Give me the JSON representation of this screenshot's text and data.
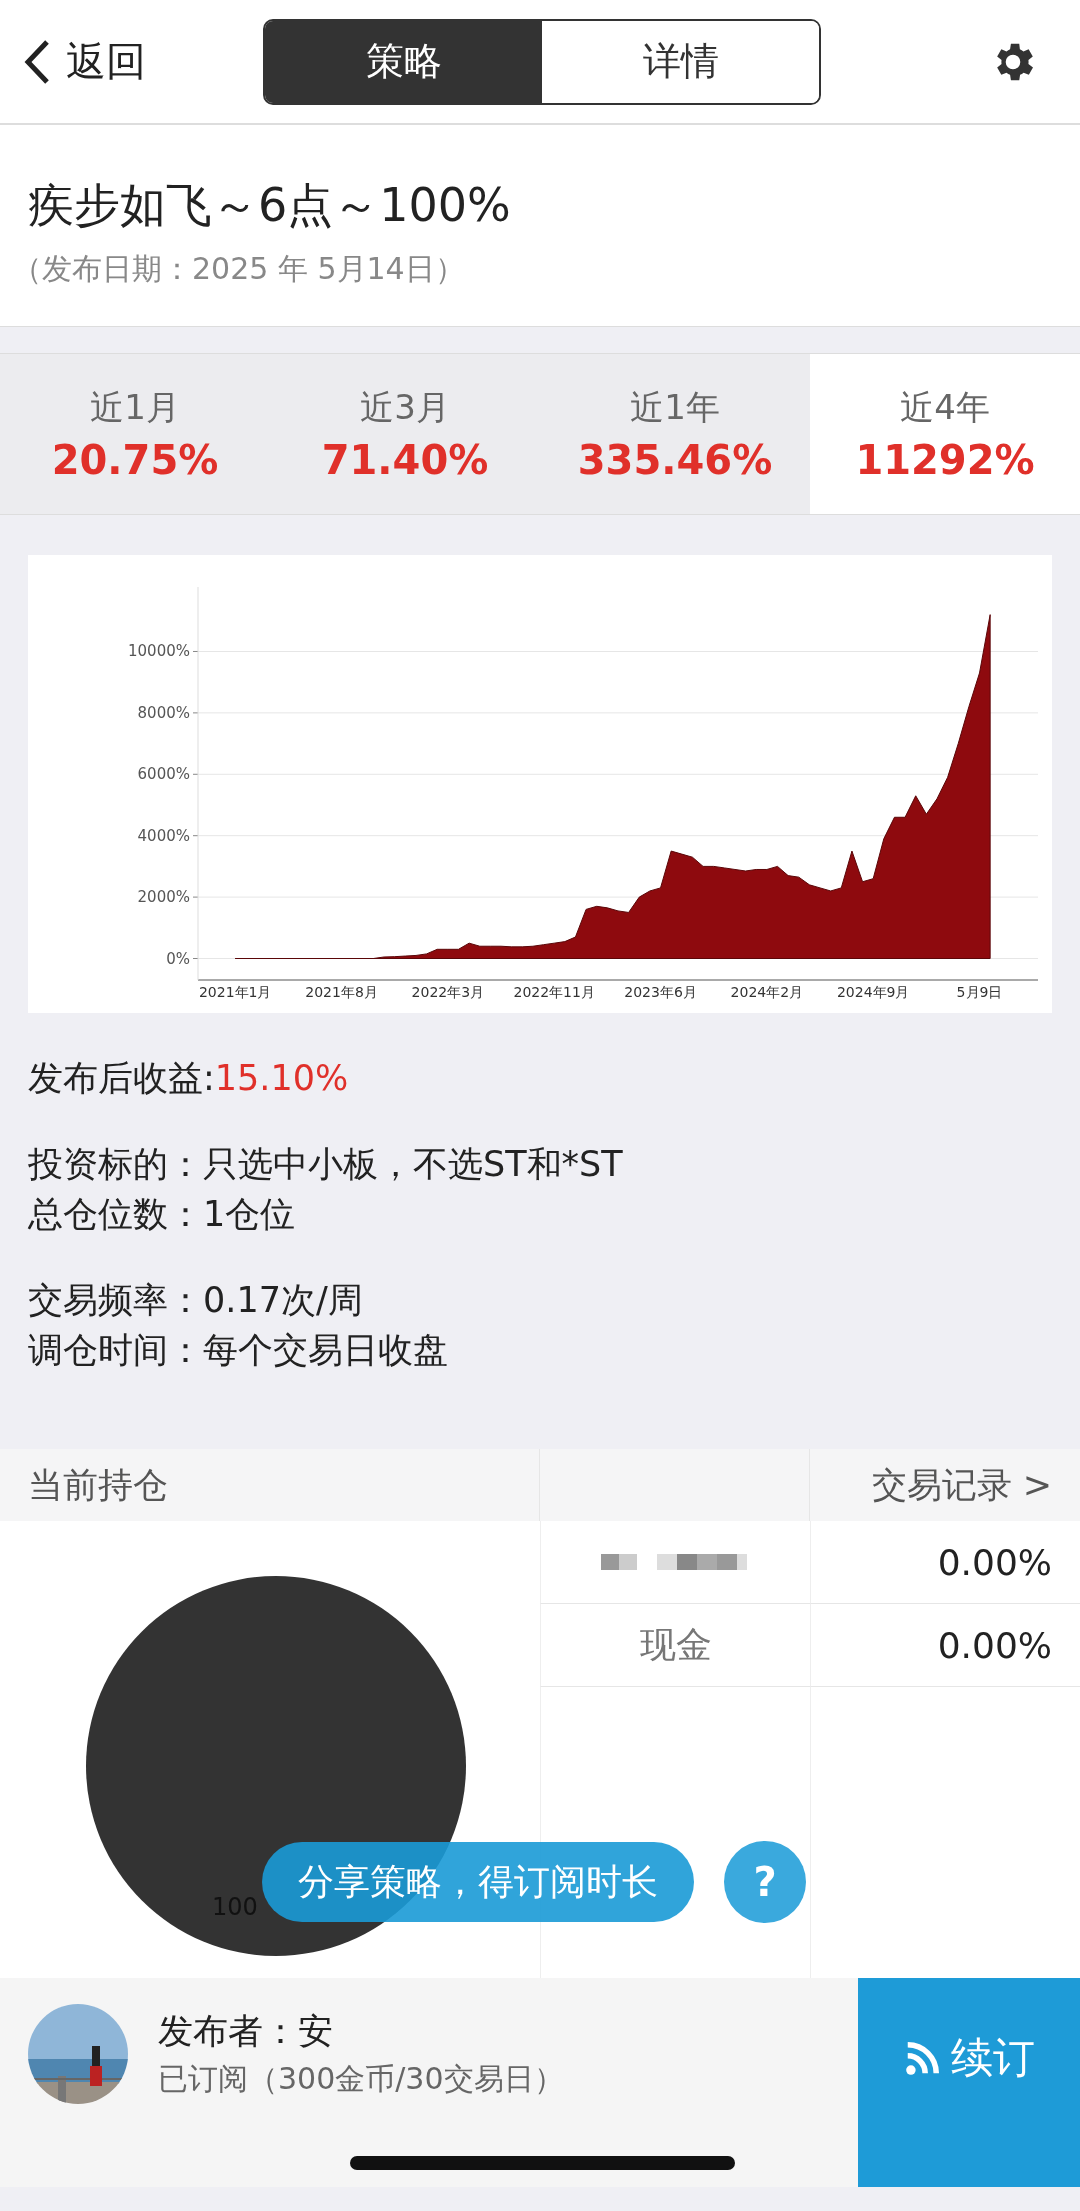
{
  "nav": {
    "back": "返回",
    "segments": [
      {
        "label": "策略",
        "selected": true
      },
      {
        "label": "详情",
        "selected": false
      }
    ]
  },
  "strategy": {
    "title": "疾步如飞～6点～100%",
    "date": "（发布日期：2025 年 5月14日）"
  },
  "periods": [
    {
      "label": "近1月",
      "value": "20.75%",
      "selected": false
    },
    {
      "label": "近3月",
      "value": "71.40%",
      "selected": false
    },
    {
      "label": "近1年",
      "value": "335.46%",
      "selected": false
    },
    {
      "label": "近4年",
      "value": "11292%",
      "selected": true
    }
  ],
  "chart_data": {
    "type": "area",
    "categories": [
      "2021年1月",
      null,
      null,
      null,
      null,
      null,
      null,
      null,
      null,
      null,
      "2021年8月",
      null,
      null,
      null,
      null,
      null,
      null,
      null,
      null,
      null,
      "2022年3月",
      null,
      null,
      null,
      null,
      null,
      null,
      null,
      null,
      null,
      "2022年11月",
      null,
      null,
      null,
      null,
      null,
      null,
      null,
      null,
      null,
      "2023年6月",
      null,
      null,
      null,
      null,
      null,
      null,
      null,
      null,
      null,
      "2024年2月",
      null,
      null,
      null,
      null,
      null,
      null,
      null,
      null,
      null,
      "2024年9月",
      null,
      null,
      null,
      null,
      null,
      null,
      null,
      null,
      null,
      "5月9日",
      null
    ],
    "series": [
      {
        "color": "#8e0a0e",
        "values": [
          0,
          0,
          0,
          0,
          0,
          0,
          0,
          0,
          0,
          0,
          0,
          0,
          0,
          0,
          50,
          60,
          80,
          100,
          150,
          300,
          300,
          300,
          500,
          400,
          400,
          400,
          380,
          380,
          400,
          450,
          500,
          550,
          700,
          1600,
          1700,
          1650,
          1550,
          1500,
          2000,
          2200,
          2300,
          3500,
          3400,
          3300,
          3000,
          3000,
          2950,
          2900,
          2850,
          2900,
          2900,
          3000,
          2700,
          2650,
          2400,
          2300,
          2200,
          2300,
          3500,
          2500,
          2600,
          3900,
          4600,
          4600,
          5300,
          4700,
          5200,
          5900,
          7000,
          8200,
          9300,
          11200
        ]
      }
    ],
    "grid": true,
    "ylim": [
      -700,
      12100
    ],
    "yticks": [
      {
        "value": 0,
        "label": "0%"
      },
      {
        "value": 2000,
        "label": "2000%"
      },
      {
        "value": 4000,
        "label": "4000%"
      },
      {
        "value": 6000,
        "label": "6000%"
      },
      {
        "value": 8000,
        "label": "8000%"
      },
      {
        "value": 10000,
        "label": "10000%"
      }
    ]
  },
  "return_after_publish": {
    "label": "发布后收益:",
    "value": "15.10%"
  },
  "info_groups": [
    [
      {
        "label": "投资标的：",
        "value": "只选中小板，不选ST和*ST"
      },
      {
        "label": "总仓位数：",
        "value": "1仓位"
      }
    ],
    [
      {
        "label": "交易频率：",
        "value": "0.17次/周"
      },
      {
        "label": "调仓时间：",
        "value": "每个交易日收盘"
      }
    ]
  ],
  "holdings": {
    "title": "当前持仓",
    "records_link": "交易记录 >",
    "pie_label": "100",
    "rows": [
      {
        "kind": "redacted",
        "weight": "0.00%"
      },
      {
        "kind": "text",
        "name": "现金",
        "weight": "0.00%"
      }
    ]
  },
  "share_banner": {
    "text": "分享策略，得订阅时长",
    "help": "?"
  },
  "publisher": {
    "name": "发布者：安",
    "subscription": "已订阅（300金币/30交易日）",
    "renew": "续订"
  }
}
